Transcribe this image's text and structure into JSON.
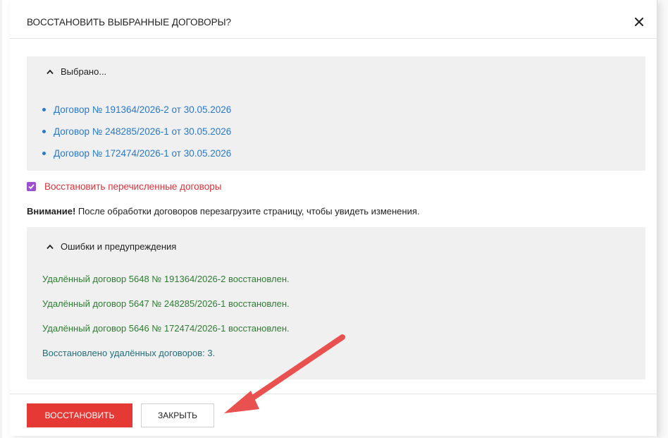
{
  "dialog": {
    "title": "ВОССТАНОВИТЬ ВЫБРАННЫЕ ДОГОВОРЫ?",
    "close_icon": "close-icon"
  },
  "selected_panel": {
    "heading": "Выбрано...",
    "items": [
      "Договор № 191364/2026-2 от 30.05.2026",
      "Договор № 248285/2026-1 от 30.05.2026",
      "Договор № 172474/2026-1 от 30.05.2026"
    ]
  },
  "restore_checkbox": {
    "label": "Восстановить перечисленные договоры",
    "checked": true
  },
  "notice": {
    "bold": "Внимание!",
    "text": " После обработки договоров перезагрузите страницу, чтобы увидеть изменения."
  },
  "errors_panel": {
    "heading": "Ошибки и предупреждения",
    "messages": [
      "Удалённый договор 5648 № 191364/2026-2 восстановлен.",
      "Удалённый договор 5647 № 248285/2026-1 восстановлен.",
      "Удалённый договор 5646 № 172474/2026-1 восстановлен."
    ],
    "summary": "Восстановлено удалённых договоров: 3."
  },
  "footer": {
    "restore_label": "ВОССТАНОВИТЬ",
    "close_label": "ЗАКРЫТЬ"
  },
  "colors": {
    "accent_red": "#e53935",
    "link_blue": "#2a78c8",
    "success_green": "#2e7d32",
    "info_teal": "#1f6f7a",
    "checkbox_purple": "#9b4fd1",
    "annotation_arrow": "#e8514f"
  }
}
